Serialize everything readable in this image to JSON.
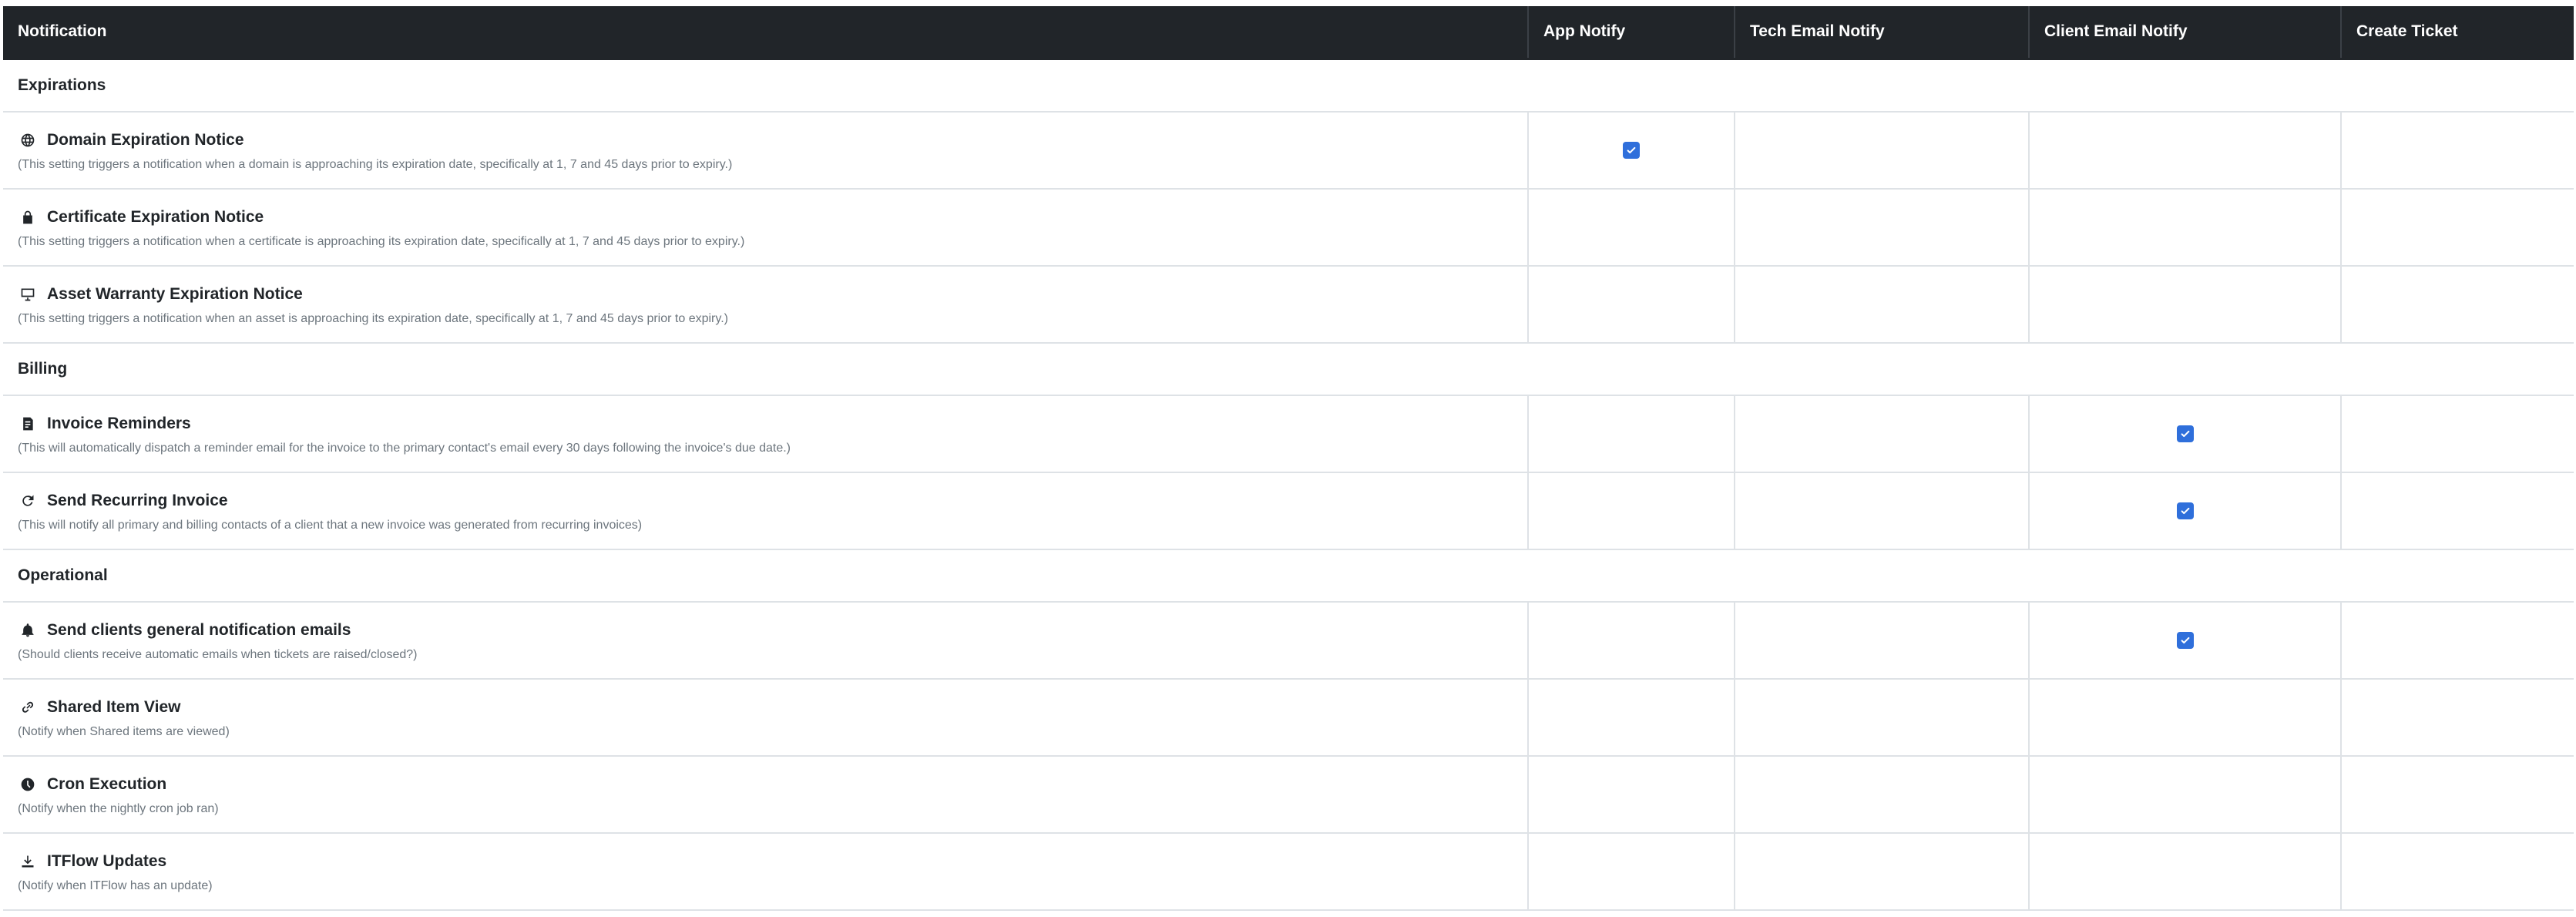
{
  "table": {
    "headers": [
      {
        "label": "Notification"
      },
      {
        "label": "App Notify"
      },
      {
        "label": "Tech Email Notify"
      },
      {
        "label": "Client Email Notify"
      },
      {
        "label": "Create Ticket"
      }
    ],
    "sections": [
      {
        "name": "Expirations",
        "items": [
          {
            "icon": "globe-icon",
            "title": "Domain Expiration Notice",
            "description": "(This setting triggers a notification when a domain is approaching its expiration date, specifically at 1, 7 and 45 days prior to expiry.)",
            "app_notify": true,
            "tech_email_notify": false,
            "client_email_notify": false,
            "create_ticket": false
          },
          {
            "icon": "lock-icon",
            "title": "Certificate Expiration Notice",
            "description": "(This setting triggers a notification when a certificate is approaching its expiration date, specifically at 1, 7 and 45 days prior to expiry.)",
            "app_notify": false,
            "tech_email_notify": false,
            "client_email_notify": false,
            "create_ticket": false
          },
          {
            "icon": "desktop-icon",
            "title": "Asset Warranty Expiration Notice",
            "description": "(This setting triggers a notification when an asset is approaching its expiration date, specifically at 1, 7 and 45 days prior to expiry.)",
            "app_notify": false,
            "tech_email_notify": false,
            "client_email_notify": false,
            "create_ticket": false
          }
        ]
      },
      {
        "name": "Billing",
        "items": [
          {
            "icon": "invoice-icon",
            "title": "Invoice Reminders",
            "description": "(This will automatically dispatch a reminder email for the invoice to the primary contact's email every 30 days following the invoice's due date.)",
            "app_notify": false,
            "tech_email_notify": false,
            "client_email_notify": true,
            "create_ticket": false
          },
          {
            "icon": "redo-icon",
            "title": "Send Recurring Invoice",
            "description": "(This will notify all primary and billing contacts of a client that a new invoice was generated from recurring invoices)",
            "app_notify": false,
            "tech_email_notify": false,
            "client_email_notify": true,
            "create_ticket": false
          }
        ]
      },
      {
        "name": "Operational",
        "items": [
          {
            "icon": "bell-icon",
            "title": "Send clients general notification emails",
            "description": "(Should clients receive automatic emails when tickets are raised/closed?)",
            "app_notify": false,
            "tech_email_notify": false,
            "client_email_notify": true,
            "create_ticket": false
          },
          {
            "icon": "link-icon",
            "title": "Shared Item View",
            "description": "(Notify when Shared items are viewed)",
            "app_notify": false,
            "tech_email_notify": false,
            "client_email_notify": false,
            "create_ticket": false
          },
          {
            "icon": "clock-icon",
            "title": "Cron Execution",
            "description": "(Notify when the nightly cron job ran)",
            "app_notify": false,
            "tech_email_notify": false,
            "client_email_notify": false,
            "create_ticket": false
          },
          {
            "icon": "download-icon",
            "title": "ITFlow Updates",
            "description": "(Notify when ITFlow has an update)",
            "app_notify": false,
            "tech_email_notify": false,
            "client_email_notify": false,
            "create_ticket": false
          }
        ]
      }
    ]
  },
  "colors": {
    "header_bg": "#212529",
    "checkbox_checked": "#2f6fdb",
    "border": "#dee2e6",
    "description_text": "#6c757d"
  }
}
